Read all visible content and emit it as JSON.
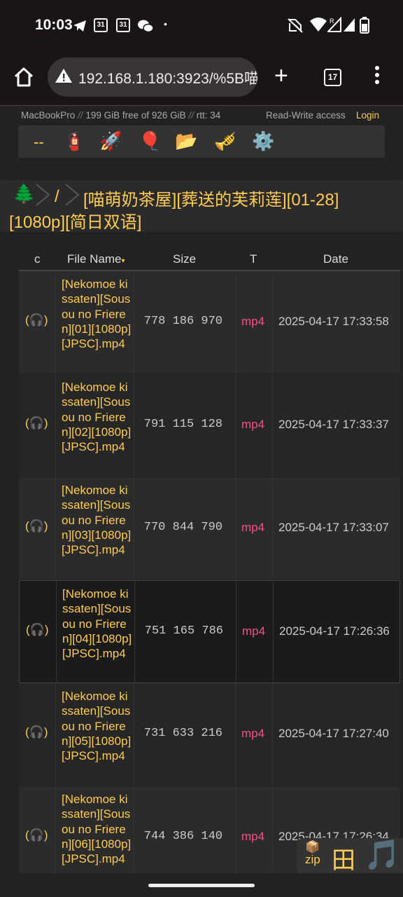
{
  "status": {
    "time": "10:03",
    "cal1": "31",
    "cal2": "31"
  },
  "browser": {
    "url": "192.168.1.180:3923/%5B喵",
    "tab_count": "17"
  },
  "server": {
    "host": "MacBookPro",
    "sep": "//",
    "disk": "199 GiB free of 926 GiB",
    "rtt": "rtt: 34",
    "access": "Read-Write access",
    "login": "Login"
  },
  "ops": {
    "dash": "--",
    "icons": [
      "fire-extinguisher-icon",
      "rocket-icon",
      "balloon-icon",
      "open-folder-icon",
      "trumpet-icon",
      "gear-icon"
    ]
  },
  "breadcrumb": {
    "root_icon": "🌲",
    "slash": "/",
    "dir_line1": "[喵萌奶茶屋][葬送的芙莉莲][01-28]",
    "dir_line2": "[1080p][简日双语]"
  },
  "table": {
    "headers": {
      "c": "c",
      "name": "File Name",
      "sort_arrow": "▾",
      "size": "Size",
      "type": "T",
      "date": "Date"
    },
    "rows": [
      {
        "play": "(🎧)",
        "name": "[Nekomoe kissaten][Sousou no Frieren][01][1080p][JPSC].mp4",
        "size": "778 186 970",
        "type": "mp4",
        "date": "2025-04-17 17:33:58"
      },
      {
        "play": "(🎧)",
        "name": "[Nekomoe kissaten][Sousou no Frieren][02][1080p][JPSC].mp4",
        "size": "791 115 128",
        "type": "mp4",
        "date": "2025-04-17 17:33:37"
      },
      {
        "play": "(🎧)",
        "name": "[Nekomoe kissaten][Sousou no Frieren][03][1080p][JPSC].mp4",
        "size": "770 844 790",
        "type": "mp4",
        "date": "2025-04-17 17:33:07"
      },
      {
        "play": "(🎧)",
        "name": "[Nekomoe kissaten][Sousou no Frieren][04][1080p][JPSC].mp4",
        "size": "751 165 786",
        "type": "mp4",
        "date": "2025-04-17 17:26:36"
      },
      {
        "play": "(🎧)",
        "name": "[Nekomoe kissaten][Sousou no Frieren][05][1080p][JPSC].mp4",
        "size": "731 633 216",
        "type": "mp4",
        "date": "2025-04-17 17:27:40"
      },
      {
        "play": "(🎧)",
        "name": "[Nekomoe kissaten][Sousou no Frieren][06][1080p][JPSC].mp4",
        "size": "744 386 140",
        "type": "mp4",
        "date": "2025-04-17 17:26:34"
      }
    ]
  },
  "widgets": {
    "zip_icon": "📦",
    "zip_label": "zip",
    "grid": "田",
    "music": "🎵"
  }
}
